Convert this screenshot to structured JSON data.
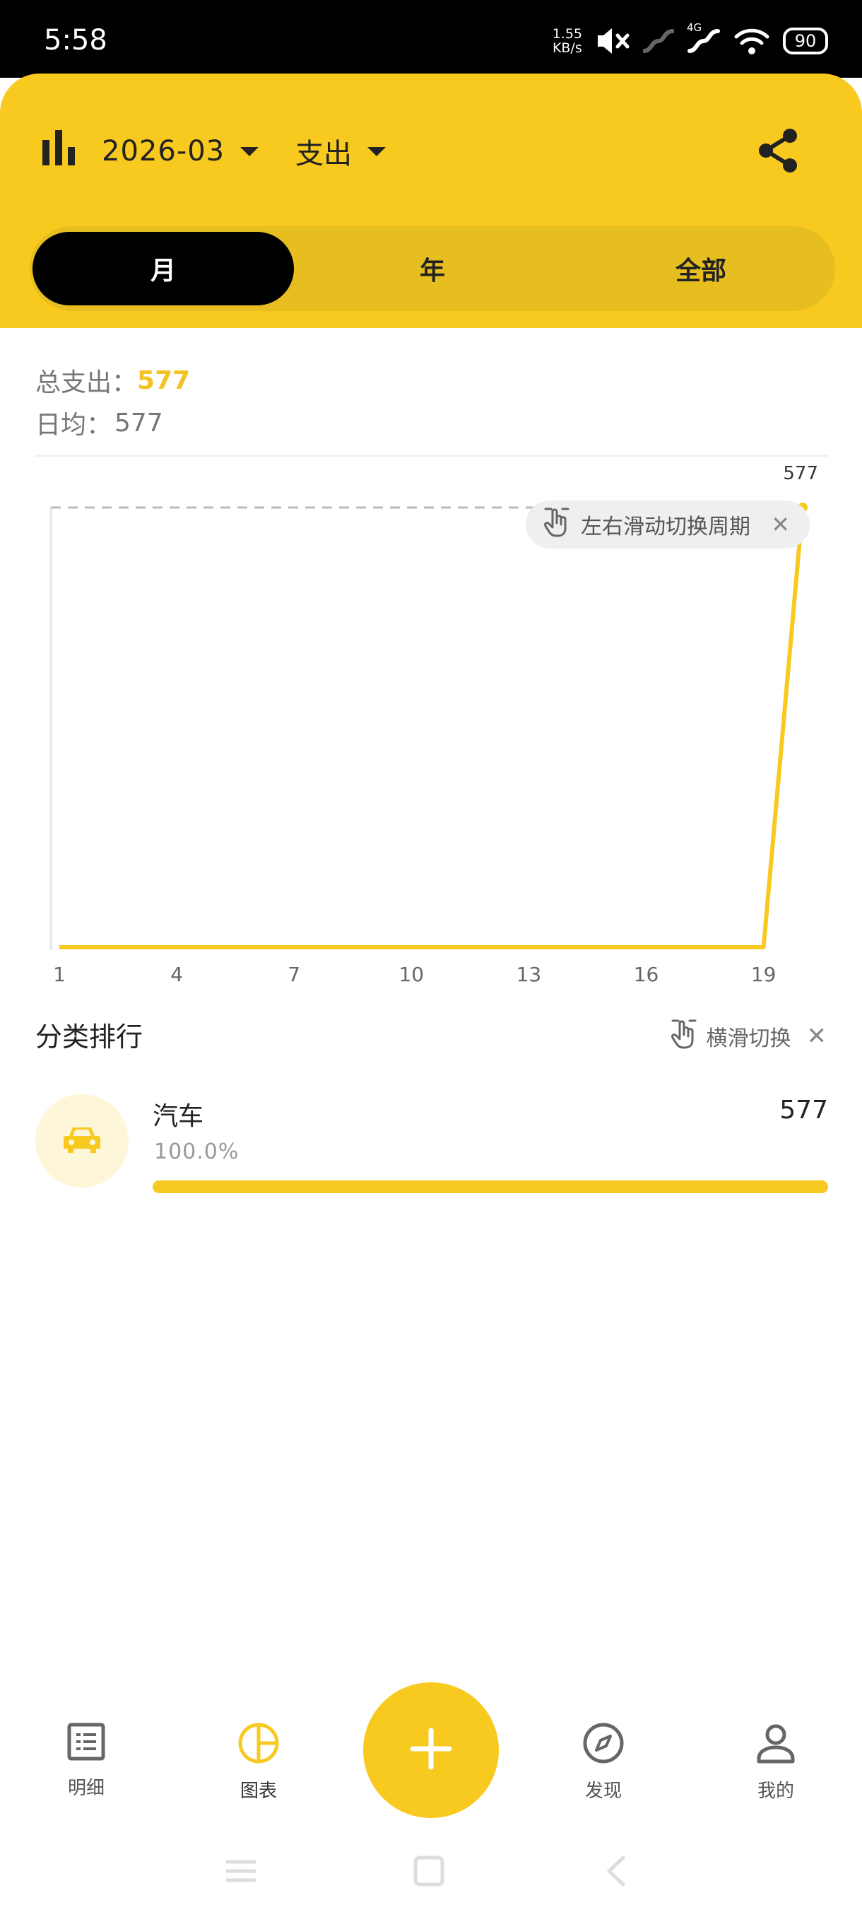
{
  "status_bar": {
    "time": "5:58",
    "net_speed_value": "1.55",
    "net_speed_unit": "KB/s",
    "signal_label": "4G",
    "battery": "90",
    "icons": [
      "mute-icon",
      "signal-icon",
      "signal-4g-icon",
      "wifi-icon",
      "battery-icon"
    ]
  },
  "header": {
    "month": "2026-03",
    "type": "支出",
    "tabs": [
      {
        "label": "月",
        "active": true
      },
      {
        "label": "年",
        "active": false
      },
      {
        "label": "全部",
        "active": false
      }
    ]
  },
  "summary": {
    "total_label": "总支出：",
    "total_value": "577",
    "avg_label": "日均：",
    "avg_value": "577"
  },
  "chart_data": {
    "type": "line",
    "x": [
      1,
      2,
      3,
      4,
      5,
      6,
      7,
      8,
      9,
      10,
      11,
      12,
      13,
      14,
      15,
      16,
      17,
      18,
      19,
      20
    ],
    "values": [
      0,
      0,
      0,
      0,
      0,
      0,
      0,
      0,
      0,
      0,
      0,
      0,
      0,
      0,
      0,
      0,
      0,
      0,
      0,
      577
    ],
    "xticks": [
      "1",
      "4",
      "7",
      "10",
      "13",
      "16",
      "19"
    ],
    "max_label": "577",
    "ylim": [
      0,
      577
    ],
    "grid": false,
    "color": "#F8C91F"
  },
  "chart_hint": {
    "text": "左右滑动切换周期",
    "close": "✕"
  },
  "ranking": {
    "title": "分类排行",
    "hint": "横滑切换",
    "close": "✕",
    "items": [
      {
        "name": "汽车",
        "amount": "577",
        "percent": "100.0%",
        "ratio": 1.0,
        "icon": "car-icon"
      }
    ]
  },
  "bottom_nav": {
    "items": [
      {
        "label": "明细",
        "icon": "list-icon"
      },
      {
        "label": "图表",
        "icon": "pie-chart-icon",
        "active": true
      },
      {
        "label": "发现",
        "icon": "compass-icon"
      },
      {
        "label": "我的",
        "icon": "profile-icon"
      }
    ],
    "fab_icon": "plus-icon"
  },
  "colors": {
    "accent": "#F8C91F",
    "segment_bg": "#E7BE1F",
    "active_tab": "#000000"
  }
}
